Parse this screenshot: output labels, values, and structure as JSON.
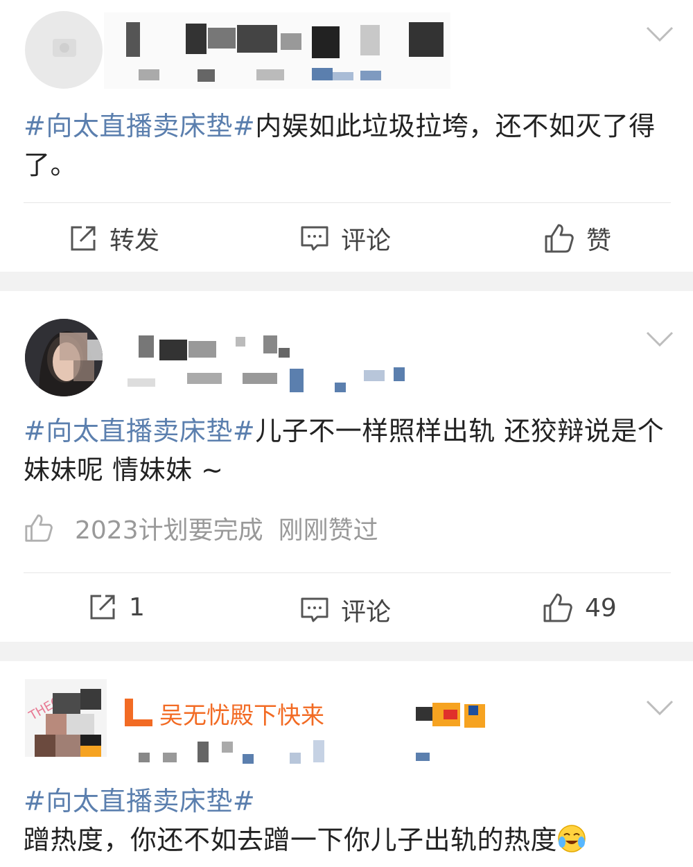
{
  "posts": [
    {
      "hashtag": "#向太直播卖床垫#",
      "text": "内娱如此垃圾拉垮，还不如灭了得了。",
      "actions": {
        "repost": "转发",
        "comment": "评论",
        "like": "赞"
      }
    },
    {
      "hashtag": "#向太直播卖床垫#",
      "text": "儿子不一样照样出轨 还狡辩说是个妹妹呢 情妹妹 ~",
      "liked_by": "2023计划要完成",
      "liked_status": "刚刚赞过",
      "actions": {
        "repost": "1",
        "comment": "评论",
        "like": "49"
      }
    },
    {
      "name_partial": "L 吴无忧殿下快来",
      "hashtag": "#向太直播卖床垫#",
      "text": "蹭热度，你还不如去蹭一下你儿子出轨的热度",
      "emoji": "crying-laughing-emoji"
    }
  ],
  "colors": {
    "hashtag": "#5b7fae",
    "text": "#222222",
    "muted": "#999999",
    "separator": "#f2f2f2"
  },
  "icons": [
    "chevron-down-icon",
    "repost-icon",
    "comment-icon",
    "thumbs-up-icon"
  ]
}
